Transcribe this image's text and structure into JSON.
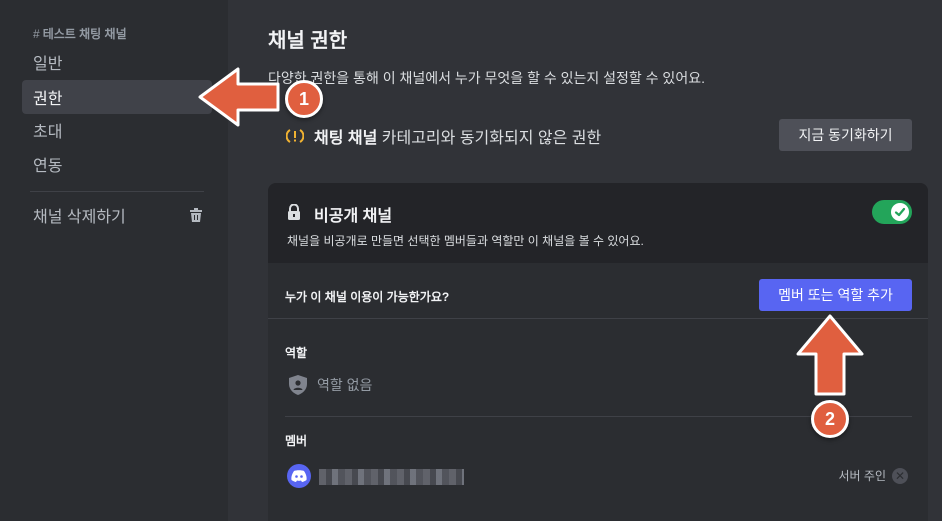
{
  "sidebar": {
    "channel_header": "테스트 채팅 채널",
    "items": [
      {
        "label": "일반"
      },
      {
        "label": "권한"
      },
      {
        "label": "초대"
      },
      {
        "label": "연동"
      }
    ],
    "delete_label": "채널 삭제하기"
  },
  "main": {
    "title": "채널 권한",
    "description": "다양한 권한을 통해 이 채널에서 누가 무엇을 할 수 있는지 설정할 수 있어요.",
    "sync": {
      "category_name": "채팅 채널",
      "text": " 카테고리와 동기화되지 않은 권한",
      "button_label": "지금 동기화하기"
    },
    "private": {
      "label": "비공개 채널",
      "description": "채널을 비공개로 만들면 선택한 멤버들과 역할만 이 채널을 볼 수 있어요.",
      "enabled": true
    },
    "access_question": "누가 이 채널 이용이 가능한가요?",
    "add_button_label": "멤버 또는 역할 추가",
    "roles_label": "역할",
    "no_roles_text": "역할 없음",
    "members_label": "멤버",
    "members": [
      {
        "badge": "서버 주인"
      }
    ]
  },
  "annotations": [
    {
      "number": "1"
    },
    {
      "number": "2"
    }
  ],
  "colors": {
    "accent": "#5865f2",
    "toggle_on": "#23a55a",
    "annotation": "#e05f3f"
  }
}
